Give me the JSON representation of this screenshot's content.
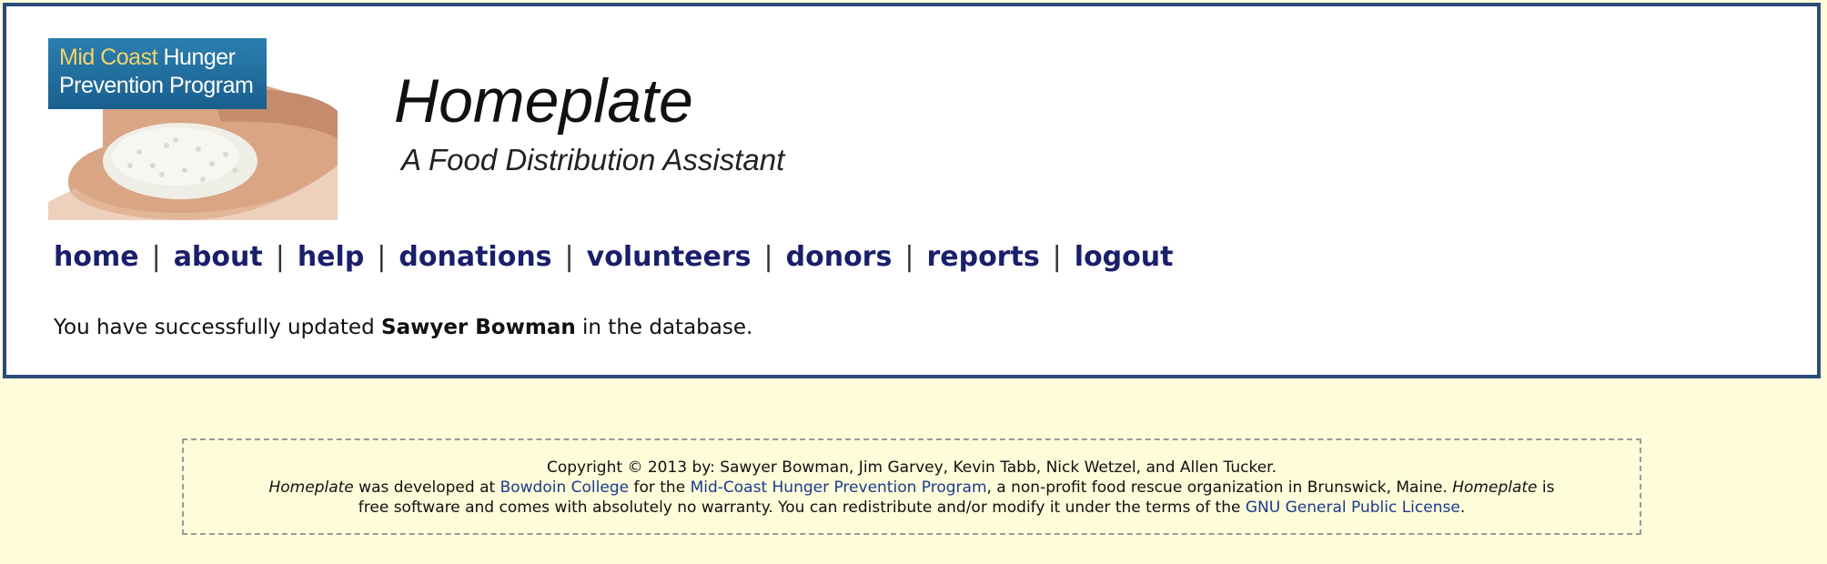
{
  "logo": {
    "line1_gold": "Mid Coast",
    "line1_rest": " Hunger",
    "line2": "Prevention Program"
  },
  "header": {
    "title": "Homeplate",
    "subtitle": "A Food Distribution Assistant"
  },
  "nav": {
    "separator": "|",
    "items": [
      "home",
      "about",
      "help",
      "donations",
      "volunteers",
      "donors",
      "reports",
      "logout"
    ]
  },
  "message": {
    "prefix": "You have successfully updated ",
    "name": "Sawyer Bowman",
    "suffix": " in the database."
  },
  "footer": {
    "copyright": "Copyright © 2013 by: Sawyer Bowman, Jim Garvey, Kevin Tabb, Nick Wetzel, and Allen Tucker.",
    "app_name": "Homeplate",
    "developed_at": " was developed at ",
    "college_link": "Bowdoin College",
    "for_text": " for the ",
    "program_link": "Mid-Coast Hunger Prevention Program",
    "org_desc": ", a non-profit food rescue organization in Brunswick, Maine. ",
    "app_name2": "Homeplate",
    "is_text": " is",
    "license_prefix": "free software and comes with absolutely no warranty. You can redistribute and/or modify it under the terms of the ",
    "license_link": "GNU General Public License",
    "license_suffix": "."
  },
  "colors": {
    "page_background": "#fefcd9",
    "border": "#2c4a7c",
    "nav_link": "#1a1f6b",
    "footer_link": "#1a3a8e",
    "logo_badge": "#1a5f8e",
    "logo_gold": "#f4d36b"
  }
}
